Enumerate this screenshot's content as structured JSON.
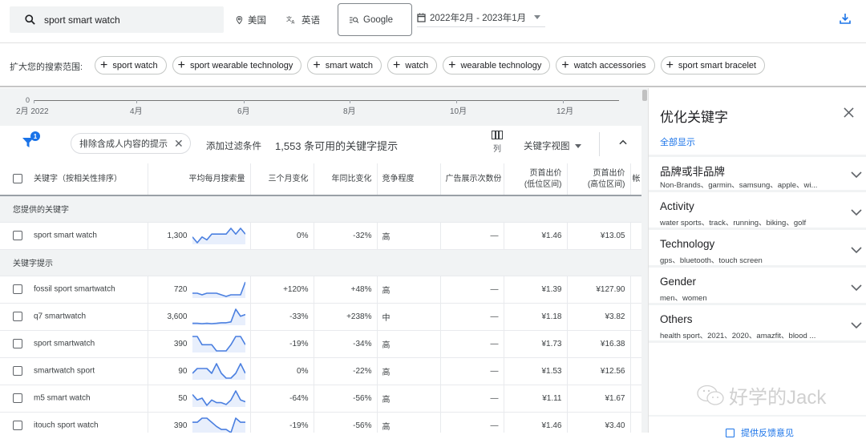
{
  "topbar": {
    "search_value": "sport smart watch",
    "location": "美国",
    "language": "英语",
    "network": "Google",
    "date_range": "2022年2月 - 2023年1月",
    "icons": [
      "search-icon",
      "location-pin-icon",
      "translate-icon",
      "search-network-icon",
      "calendar-icon",
      "download-icon"
    ]
  },
  "expand": {
    "label": "扩大您的搜索范围:",
    "chips": [
      "sport watch",
      "sport wearable technology",
      "smart watch",
      "watch",
      "wearable technology",
      "watch accessories",
      "sport smart bracelet"
    ]
  },
  "trend_axis": {
    "zero": "0",
    "ticks": [
      "2月 2022",
      "4月",
      "6月",
      "8月",
      "10月",
      "12月"
    ]
  },
  "filter_bar": {
    "filter_badge": "1",
    "adult_chip": "排除含成人内容的提示",
    "add_filter": "添加过滤条件",
    "count_text": "1,553 条可用的关键字提示",
    "columns_label": "列",
    "view_label": "关键字视图"
  },
  "table": {
    "headers": [
      "关键字（按相关性排序）",
      "平均每月搜索量",
      "三个月变化",
      "年同比变化",
      "竞争程度",
      "广告展示次数份",
      "页首出价\n(低位区间)",
      "页首出价\n(高位区间)",
      "帐"
    ],
    "sections": {
      "provided": "您提供的关键字",
      "suggestions": "关键字提示"
    },
    "provided_rows": [
      {
        "keyword": "sport smart watch",
        "volume": "1,300",
        "three_month": "0%",
        "yoy": "-32%",
        "competition": "高",
        "impression_share": "—",
        "bid_low": "¥1.46",
        "bid_high": "¥13.05",
        "trend": [
          4,
          2,
          4,
          3,
          5,
          5,
          5,
          5,
          7,
          5,
          7,
          5
        ]
      }
    ],
    "suggestion_rows": [
      {
        "keyword": "fossil sport smartwatch",
        "volume": "720",
        "three_month": "+120%",
        "yoy": "+48%",
        "competition": "高",
        "impression_share": "—",
        "bid_low": "¥1.39",
        "bid_high": "¥127.90",
        "trend": [
          3,
          3,
          2,
          3,
          3,
          3,
          2,
          1,
          2,
          2,
          2,
          10
        ]
      },
      {
        "keyword": "q7 smartwatch",
        "volume": "3,600",
        "three_month": "-33%",
        "yoy": "+238%",
        "competition": "中",
        "impression_share": "—",
        "bid_low": "¥1.18",
        "bid_high": "¥3.82",
        "trend": [
          1,
          1,
          0.8,
          1,
          0.8,
          1,
          1.3,
          1.3,
          1.8,
          9,
          5,
          6
        ]
      },
      {
        "keyword": "sport smartwatch",
        "volume": "390",
        "three_month": "-19%",
        "yoy": "-34%",
        "competition": "高",
        "impression_share": "—",
        "bid_low": "¥1.73",
        "bid_high": "¥16.38",
        "trend": [
          9,
          9,
          5,
          5,
          5,
          2,
          2,
          2,
          5,
          9,
          9,
          5
        ]
      },
      {
        "keyword": "smartwatch sport",
        "volume": "90",
        "three_month": "0%",
        "yoy": "-22%",
        "competition": "高",
        "impression_share": "—",
        "bid_low": "¥1.53",
        "bid_high": "¥12.56",
        "trend": [
          4,
          6,
          6,
          6,
          4,
          8,
          4,
          2,
          2,
          4,
          8,
          4
        ]
      },
      {
        "keyword": "m5 smart watch",
        "volume": "50",
        "three_month": "-64%",
        "yoy": "-56%",
        "competition": "高",
        "impression_share": "—",
        "bid_low": "¥1.11",
        "bid_high": "¥1.67",
        "trend": [
          7,
          4,
          5,
          1,
          4,
          2.5,
          2.5,
          1.5,
          4,
          9,
          4,
          3
        ]
      },
      {
        "keyword": "itouch sport watch",
        "volume": "390",
        "three_month": "-19%",
        "yoy": "-56%",
        "competition": "高",
        "impression_share": "—",
        "bid_low": "¥1.46",
        "bid_high": "¥3.40",
        "trend": [
          7,
          7,
          9,
          9,
          7,
          5,
          3.5,
          3.5,
          2,
          9,
          7,
          7
        ]
      }
    ]
  },
  "refine_panel": {
    "title": "优化关键字",
    "show_all": "全部显示",
    "facets": [
      {
        "name": "品牌或非品牌",
        "values": "Non-Brands、garmin、samsung、apple、wi..."
      },
      {
        "name": "Activity",
        "values": "water sports、track、running、biking、golf"
      },
      {
        "name": "Technology",
        "values": "gps、bluetooth、touch screen"
      },
      {
        "name": "Gender",
        "values": "men、women"
      },
      {
        "name": "Others",
        "values": "health sport、2021、2020、amazfit、blood ..."
      }
    ],
    "watermark": "好学的Jack",
    "feedback": "提供反馈意见"
  },
  "colors": {
    "accent": "#1a73e8",
    "sparkline": "#4a7fe0",
    "sparkline_fill": "#e8effc",
    "section_bg": "#f1f3f4"
  }
}
